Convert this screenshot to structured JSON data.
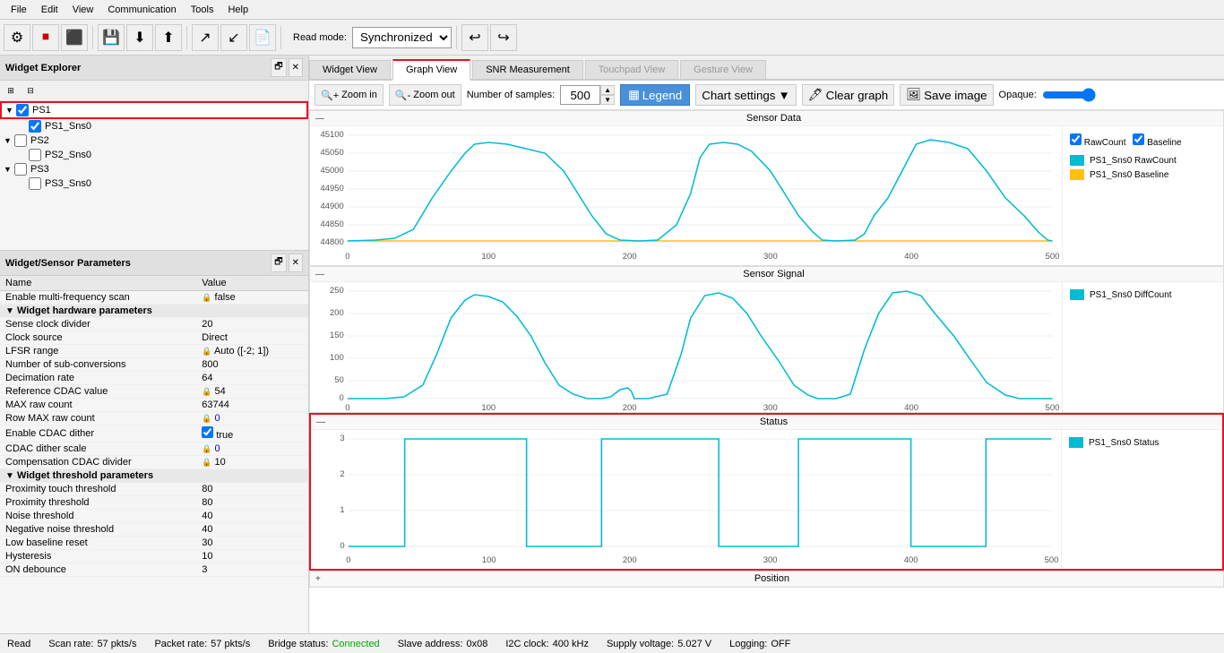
{
  "menu": {
    "items": [
      "File",
      "Edit",
      "View",
      "Communication",
      "Tools",
      "Help"
    ]
  },
  "toolbar": {
    "read_mode_label": "Read mode:",
    "read_mode_value": "Synchronized",
    "undo_icon": "↩",
    "redo_icon": "↪"
  },
  "widget_explorer": {
    "title": "Widget Explorer",
    "toolbar_icons": [
      "⊞",
      "≡"
    ],
    "tree": [
      {
        "id": "ps1",
        "label": "PS1",
        "checked": true,
        "level": 0,
        "expanded": true,
        "highlighted": true
      },
      {
        "id": "ps1_sns0",
        "label": "PS1_Sns0",
        "checked": true,
        "level": 1,
        "expanded": false
      },
      {
        "id": "ps2",
        "label": "PS2",
        "checked": false,
        "level": 0,
        "expanded": true
      },
      {
        "id": "ps2_sns0",
        "label": "PS2_Sns0",
        "checked": false,
        "level": 1
      },
      {
        "id": "ps3",
        "label": "PS3",
        "checked": false,
        "level": 0,
        "expanded": true
      }
    ]
  },
  "params_panel": {
    "title": "Widget/Sensor Parameters",
    "columns": [
      "Name",
      "Value"
    ],
    "params": [
      {
        "type": "param",
        "name": "Enable multi-frequency scan",
        "value": "false",
        "icon": "lock"
      },
      {
        "type": "section",
        "name": "Widget hardware parameters"
      },
      {
        "type": "param",
        "name": "Sense clock divider",
        "value": "20"
      },
      {
        "type": "param",
        "name": "Clock source",
        "value": "Direct"
      },
      {
        "type": "param",
        "name": "LFSR range",
        "value": "Auto ([-2; 1])",
        "icon": "lock"
      },
      {
        "type": "param",
        "name": "Number of sub-conversions",
        "value": "800"
      },
      {
        "type": "param",
        "name": "Decimation rate",
        "value": "64"
      },
      {
        "type": "param",
        "name": "Reference CDAC value",
        "value": "54",
        "icon": "lock"
      },
      {
        "type": "param",
        "name": "MAX raw count",
        "value": "63744"
      },
      {
        "type": "param",
        "name": "Row MAX raw count",
        "value": "0",
        "icon": "lock",
        "value_blue": true
      },
      {
        "type": "param",
        "name": "Enable CDAC dither",
        "value": "true",
        "checked": true
      },
      {
        "type": "param",
        "name": "CDAC dither scale",
        "value": "0",
        "icon": "lock",
        "value_blue": true
      },
      {
        "type": "param",
        "name": "Compensation CDAC divider",
        "value": "10",
        "icon": "lock"
      },
      {
        "type": "section",
        "name": "Widget threshold parameters"
      },
      {
        "type": "param",
        "name": "Proximity touch threshold",
        "value": "80"
      },
      {
        "type": "param",
        "name": "Proximity threshold",
        "value": "80"
      },
      {
        "type": "param",
        "name": "Noise threshold",
        "value": "40"
      },
      {
        "type": "param",
        "name": "Negative noise threshold",
        "value": "40"
      },
      {
        "type": "param",
        "name": "Low baseline reset",
        "value": "30"
      },
      {
        "type": "param",
        "name": "Hysteresis",
        "value": "10"
      },
      {
        "type": "param",
        "name": "ON debounce",
        "value": "3"
      }
    ]
  },
  "tabs": {
    "items": [
      {
        "id": "widget-view",
        "label": "Widget View",
        "active": false,
        "disabled": false
      },
      {
        "id": "graph-view",
        "label": "Graph View",
        "active": true,
        "disabled": false
      },
      {
        "id": "snr-measurement",
        "label": "SNR Measurement",
        "active": false,
        "disabled": false
      },
      {
        "id": "touchpad-view",
        "label": "Touchpad View",
        "active": false,
        "disabled": true
      },
      {
        "id": "gesture-view",
        "label": "Gesture View",
        "active": false,
        "disabled": true
      }
    ]
  },
  "graph_toolbar": {
    "zoom_in": "Zoom in",
    "zoom_out": "Zoom out",
    "samples_label": "Number of samples:",
    "samples_value": "500",
    "legend_label": "Legend",
    "chart_settings": "Chart settings",
    "clear_graph": "Clear graph",
    "save_image": "Save image",
    "opaque_label": "Opaque:"
  },
  "charts": [
    {
      "id": "sensor-data",
      "title": "Sensor Data",
      "collapsed": false,
      "y_min": 44800,
      "y_max": 45100,
      "y_ticks": [
        44800,
        44850,
        44900,
        44950,
        45000,
        45050,
        45100
      ],
      "x_ticks": [
        0,
        100,
        200,
        300,
        400,
        500
      ],
      "legend": [
        {
          "label": "PS1_Sns0 RawCount",
          "color": "#00bcd4",
          "checked": true,
          "checkbox_label": "RawCount"
        },
        {
          "label": "PS1_Sns0 Baseline",
          "color": "#ffc107",
          "checked": true,
          "checkbox_label": "Baseline"
        }
      ]
    },
    {
      "id": "sensor-signal",
      "title": "Sensor Signal",
      "collapsed": false,
      "y_min": 0,
      "y_max": 250,
      "y_ticks": [
        0,
        50,
        100,
        150,
        200,
        250
      ],
      "x_ticks": [
        0,
        100,
        200,
        300,
        400,
        500
      ],
      "legend": [
        {
          "label": "PS1_Sns0 DiffCount",
          "color": "#00bcd4",
          "checked": true
        }
      ]
    },
    {
      "id": "status",
      "title": "Status",
      "collapsed": false,
      "highlighted": true,
      "y_min": 0,
      "y_max": 3,
      "y_ticks": [
        0,
        1,
        2,
        3
      ],
      "x_ticks": [
        0,
        100,
        200,
        300,
        400,
        500
      ],
      "legend": [
        {
          "label": "PS1_Sns0 Status",
          "color": "#00bcd4",
          "checked": true
        }
      ]
    },
    {
      "id": "position",
      "title": "Position",
      "collapsed": true,
      "legend": []
    }
  ],
  "status_bar": {
    "mode": "Read",
    "scan_rate_label": "Scan rate:",
    "scan_rate_value": "57 pkts/s",
    "packet_rate_label": "Packet rate:",
    "packet_rate_value": "57 pkts/s",
    "bridge_status_label": "Bridge status:",
    "bridge_status_value": "Connected",
    "slave_address_label": "Slave address:",
    "slave_address_value": "0x08",
    "i2c_clock_label": "I2C clock:",
    "i2c_clock_value": "400 kHz",
    "supply_voltage_label": "Supply voltage:",
    "supply_voltage_value": "5.027 V",
    "logging_label": "Logging:",
    "logging_value": "OFF"
  }
}
